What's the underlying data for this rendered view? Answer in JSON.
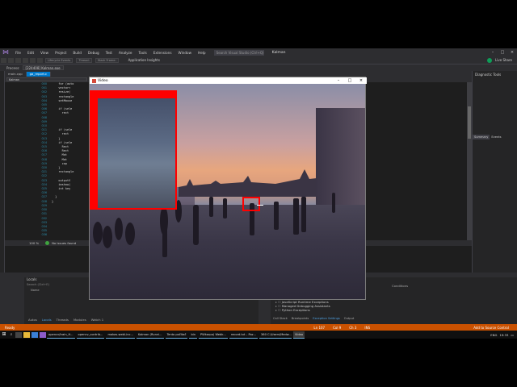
{
  "vs": {
    "menu": [
      "File",
      "Edit",
      "View",
      "Project",
      "Build",
      "Debug",
      "Test",
      "Analyze",
      "Tools",
      "Extensions",
      "Window",
      "Help"
    ],
    "search_placeholder": "Search Visual Studio (Ctrl+Q)",
    "title": "Kalman",
    "app_insights": "Application Insights",
    "live_share": "Live Share",
    "user_initials": "VS",
    "process_label": "Process:",
    "process_value": "[224408] Kalman.exe",
    "toolbar_gray": [
      "Lifecycle Events",
      "Thread:",
      "Stack Frame:"
    ],
    "tabs": [
      "main.cpp",
      "ga_report.c",
      "Kalman"
    ],
    "nav_dd": [
      "Kalman",
      "(Global Scope)",
      "main(int argc, char** argv)"
    ],
    "line_numbers": [
      "000",
      "001",
      "002",
      "003",
      "004",
      "005",
      "006",
      "007",
      "008",
      "009",
      "010",
      "011",
      "012",
      "013",
      "014",
      "015",
      "016",
      "017",
      "018",
      "019",
      "020",
      "021",
      "022",
      "023",
      "024",
      "025",
      "026",
      "027",
      "028",
      "029",
      "030",
      "031",
      "032",
      "033",
      "034",
      "035",
      "036"
    ],
    "code_lines": [
      "    for (auto",
      "    vector<",
      "    resize(",
      "    rectangle",
      "    setMouse",
      "",
      "    if (sele",
      "      rect",
      "",
      "",
      "",
      "    if (sele",
      "      rect",
      "    }",
      "    if (sele",
      "      Rect",
      "      Rect",
      "      Mat",
      "      Mat",
      "      cop",
      "    }",
      "    rectangle",
      "",
      "    outputV",
      "    imshow(",
      "    int key",
      "",
      "  }",
      "}"
    ],
    "code_right": "0, 255, 255), 4, 8, 0);",
    "zoom_level": "100 %",
    "no_issues": "No issues found",
    "locals_title": "Locals",
    "locals_search": "Search (Ctrl+E)",
    "locals_col": "Name",
    "bottom_tabs": [
      "Autos",
      "Locals",
      "Threads",
      "Modules",
      "Watch 1"
    ],
    "exc_conditions": "Conditions",
    "exc_list": [
      "JavaScript Runtime Exceptions",
      "Managed Debugging Assistants",
      "Python Exceptions"
    ],
    "exc_tabs": [
      "Call Stack",
      "Breakpoints",
      "Exception Settings",
      "Output"
    ],
    "diag_title": "Diagnostic Tools",
    "diag_tabs": [
      "Summary",
      "Events"
    ],
    "status_ready": "Ready",
    "status_ln": "Ln 107",
    "status_col": "Col 9",
    "status_ch": "Ch 3",
    "status_ins": "INS",
    "status_source": "Add to Source Control"
  },
  "taskbar": {
    "tasks": [
      "opencv/train_H...",
      "opencv_contrib...",
      "makas-webl-inc...",
      "Kalman (Runni...",
      "Tento počítač",
      "bin",
      "PWkarpo) Webk...",
      "record.txt – Poz...",
      "360 C:\\Users\\Medw...",
      "Video"
    ],
    "lang": "ENG",
    "time": "19:33"
  },
  "video": {
    "title": "Video",
    "colors": {
      "box": "#ff0000"
    }
  }
}
